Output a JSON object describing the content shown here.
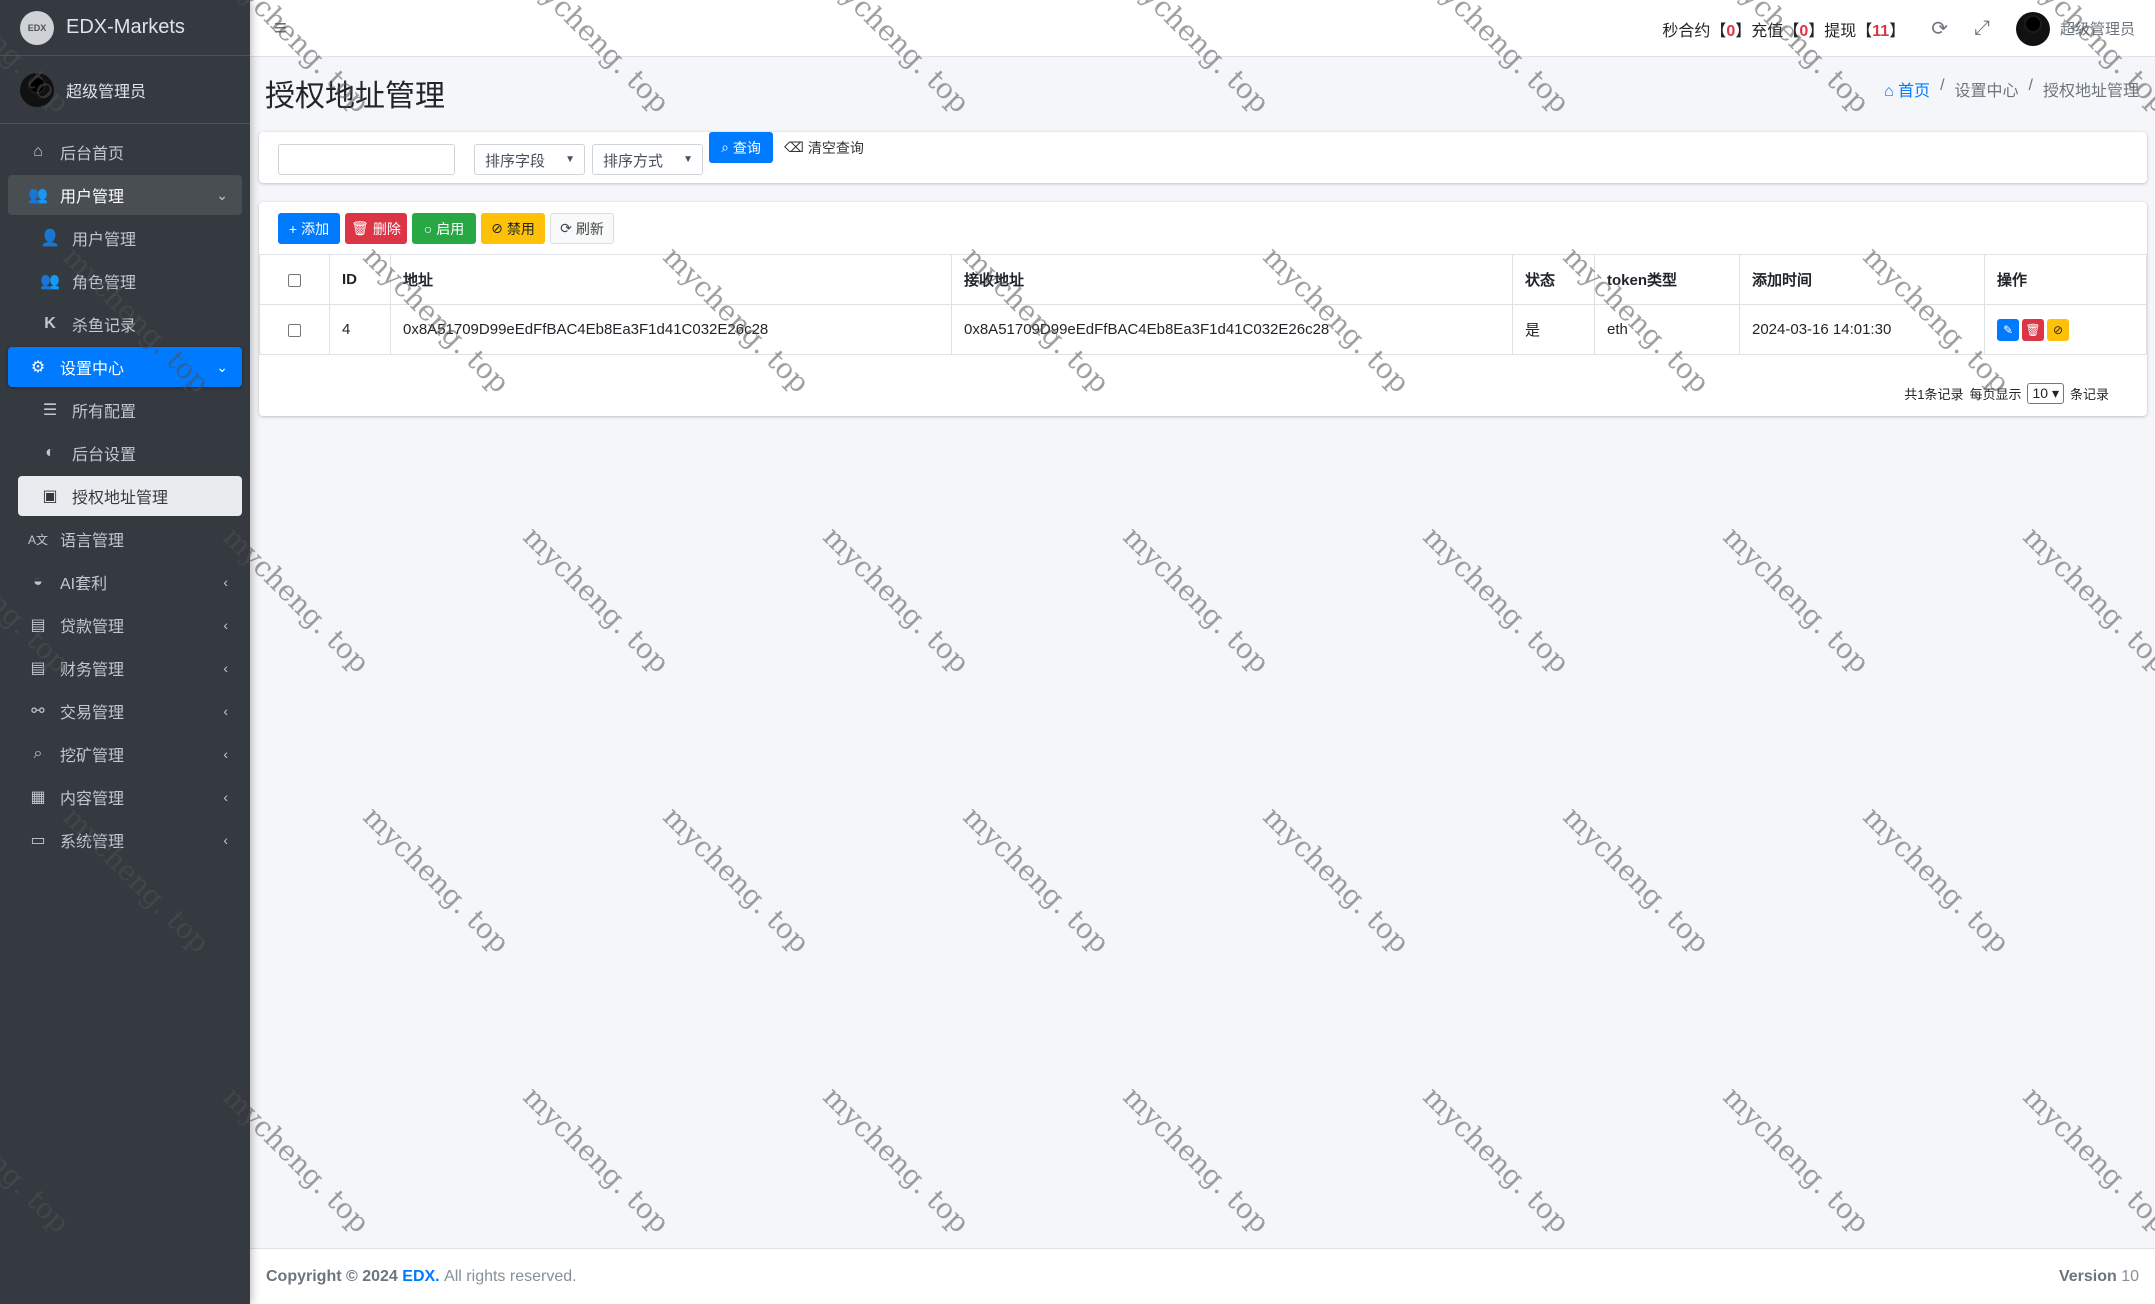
{
  "brand": {
    "logo_text": "EDX",
    "name": "EDX-Markets"
  },
  "sidebar": {
    "user_name": "超级管理员",
    "items": [
      {
        "label": "后台首页",
        "icon": "home-icon"
      },
      {
        "label": "用户管理",
        "icon": "users-icon"
      },
      {
        "label": "用户管理",
        "icon": "user-icon"
      },
      {
        "label": "角色管理",
        "icon": "users-icon"
      },
      {
        "label": "杀鱼记录",
        "icon": "k-icon"
      },
      {
        "label": "设置中心",
        "icon": "cogs-icon"
      },
      {
        "label": "所有配置",
        "icon": "list-icon"
      },
      {
        "label": "后台设置",
        "icon": "half-circle-icon"
      },
      {
        "label": "授权地址管理",
        "icon": "id-badge-icon"
      },
      {
        "label": "语言管理",
        "icon": "language-icon"
      },
      {
        "label": "AI套利",
        "icon": "android-icon"
      },
      {
        "label": "贷款管理",
        "icon": "money-icon"
      },
      {
        "label": "财务管理",
        "icon": "money-icon"
      },
      {
        "label": "交易管理",
        "icon": "exchange-icon"
      },
      {
        "label": "挖矿管理",
        "icon": "search-dollar-icon"
      },
      {
        "label": "内容管理",
        "icon": "newspaper-icon"
      },
      {
        "label": "系统管理",
        "icon": "desktop-icon"
      }
    ]
  },
  "header": {
    "stats": {
      "label1": "秒合约",
      "val1": "0",
      "label2": "充值",
      "val2": "0",
      "label3": "提现",
      "val3": "11"
    },
    "user_name": "超级管理员"
  },
  "page": {
    "title": "授权地址管理",
    "breadcrumb": {
      "home": "首页",
      "level2": "设置中心",
      "level3": "授权地址管理"
    }
  },
  "filter": {
    "search_value": "",
    "sort_field": "排序字段",
    "sort_order": "排序方式",
    "query_label": "查询",
    "clear_label": "清空查询"
  },
  "toolbar": {
    "add": "添加",
    "delete": "删除",
    "enable": "启用",
    "disable": "禁用",
    "refresh": "刷新"
  },
  "table": {
    "headers": [
      "ID",
      "地址",
      "接收地址",
      "状态",
      "token类型",
      "添加时间",
      "操作"
    ],
    "rows": [
      {
        "id": "4",
        "address": "0x8A51709D99eEdFfBAC4Eb8Ea3F1d41C032E26c28",
        "receive_address": "0x8A51709D99eEdFfBAC4Eb8Ea3F1d41C032E26c28",
        "status": "是",
        "token": "eth",
        "time": "2024-03-16 14:01:30"
      }
    ]
  },
  "pager": {
    "total": "共1条记录",
    "per_page_label": "每页显示",
    "per_page": "10",
    "suffix": "条记录"
  },
  "footer": {
    "copyright": "Copyright © 2024",
    "brand": "EDX.",
    "rights": "All rights reserved.",
    "version_label": "Version",
    "version": "10"
  },
  "watermark": {
    "text": "mycheng. top"
  }
}
